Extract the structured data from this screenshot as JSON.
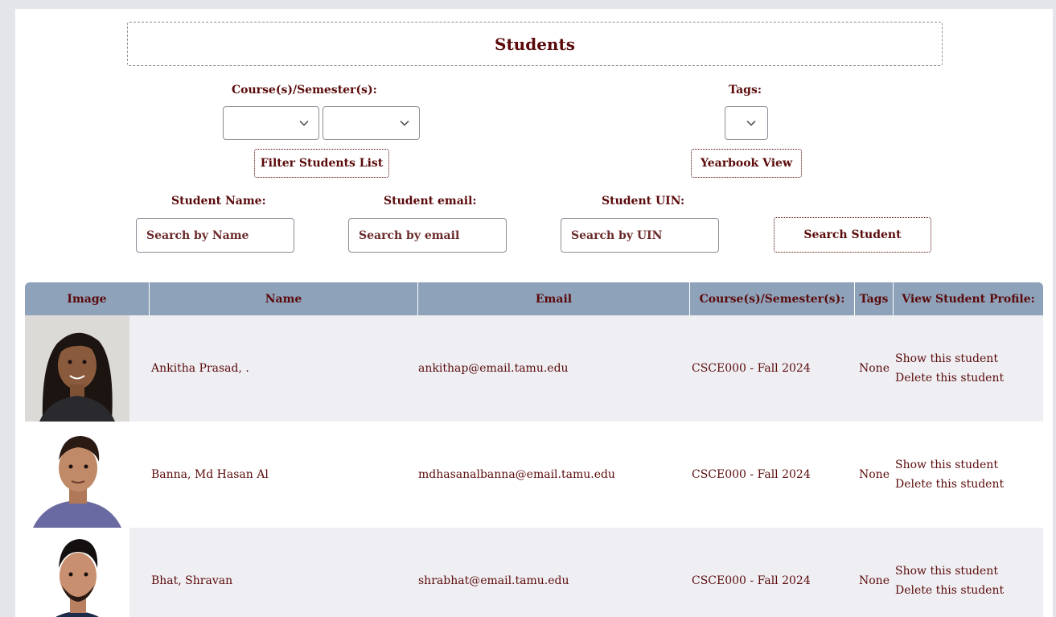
{
  "page": {
    "title": "Students"
  },
  "filters": {
    "course_label": "Course(s)/Semester(s):",
    "tags_label": "Tags:",
    "filter_button": "Filter Students List",
    "yearbook_button": "Yearbook View"
  },
  "search": {
    "name_label": "Student Name:",
    "name_placeholder": "Search by Name",
    "email_label": "Student email:",
    "email_placeholder": "Search by email",
    "uin_label": "Student UIN:",
    "uin_placeholder": "Search by UIN",
    "search_button": "Search Student"
  },
  "table": {
    "headers": {
      "image": "Image",
      "name": "Name",
      "email": "Email",
      "course": "Course(s)/Semester(s):",
      "tags": "Tags",
      "profile": "View Student Profile:"
    },
    "rows": [
      {
        "name": "Ankitha Prasad, .",
        "email": "ankithap@email.tamu.edu",
        "course": "CSCE000 - Fall 2024",
        "tags": "None",
        "show": "Show this student",
        "delete": "Delete this student"
      },
      {
        "name": "Banna, Md Hasan Al",
        "email": "mdhasanalbanna@email.tamu.edu",
        "course": "CSCE000 - Fall 2024",
        "tags": "None",
        "show": "Show this student",
        "delete": "Delete this student"
      },
      {
        "name": "Bhat, Shravan",
        "email": "shrabhat@email.tamu.edu",
        "course": "CSCE000 - Fall 2024",
        "tags": "None",
        "show": "Show this student",
        "delete": "Delete this student"
      }
    ]
  },
  "colors": {
    "text": "#5a0a0a",
    "header_bg": "#8ea2ba",
    "row_alt_bg": "#efeff3",
    "page_bg": "#e4e5ea"
  },
  "icons": {
    "select_caret": "chevron-down-icon"
  }
}
